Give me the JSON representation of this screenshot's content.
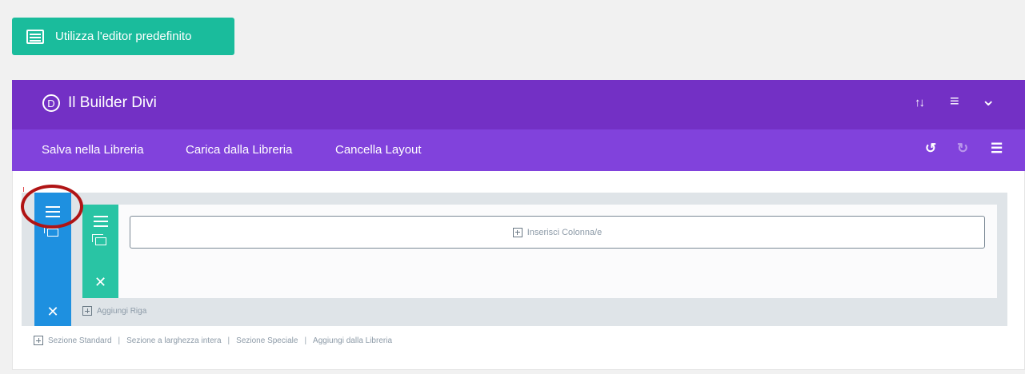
{
  "default_editor_button": {
    "label": "Utilizza l'editor predefinito"
  },
  "header": {
    "logo_letter": "D",
    "title": "Il Builder Divi",
    "sort_icon": "↑↓",
    "menu_icon": "≡",
    "collapse_icon": "⌄"
  },
  "toolbar": {
    "save_library": "Salva nella Libreria",
    "load_library": "Carica dalla Libreria",
    "clear_layout": "Cancella Layout",
    "undo_icon": "↺",
    "redo_icon": "↻",
    "history_icon": "☰"
  },
  "section": {
    "insert_column": "Inserisci Colonna/e",
    "add_row": "Aggiungi Riga"
  },
  "section_links": {
    "standard": "Sezione Standard",
    "full_width": "Sezione a larghezza intera",
    "special": "Sezione Speciale",
    "from_library": "Aggiungi dalla Libreria",
    "separator": "|"
  },
  "colors": {
    "teal": "#1abc9c",
    "purple_dark": "#7330c5",
    "purple_light": "#8142dc",
    "blue": "#1e90e0",
    "row_teal": "#29c4a4",
    "annotation_red": "#b01415"
  }
}
